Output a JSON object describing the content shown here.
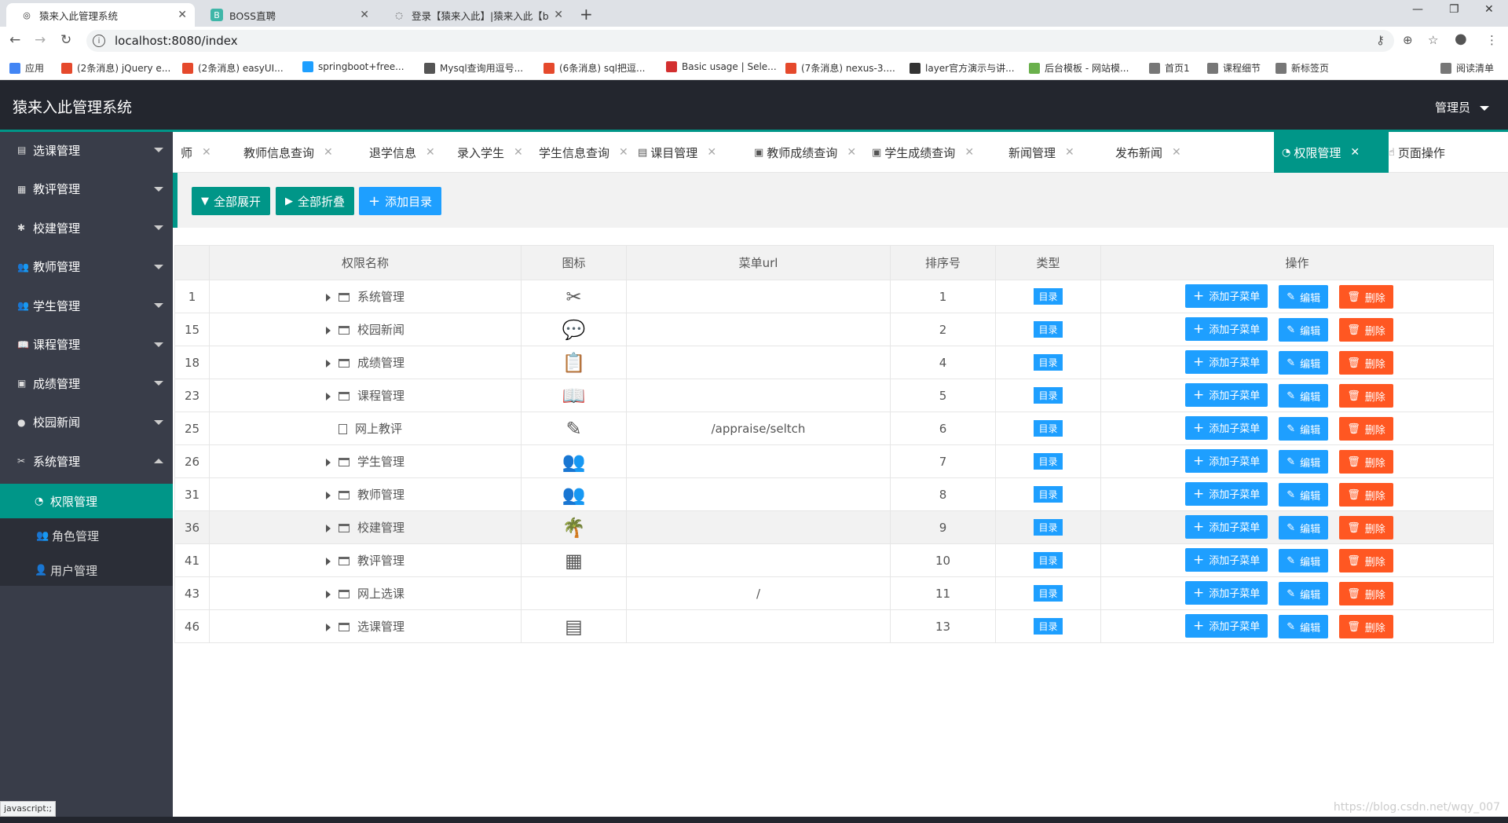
{
  "browser": {
    "tabs": [
      {
        "title": "猿来入此管理系统",
        "active": true
      },
      {
        "title": "BOSS直聘",
        "active": false
      },
      {
        "title": "登录【猿来入此】|猿来入此【be",
        "active": false
      }
    ],
    "url": "localhost:8080/index"
  },
  "bookmarks": [
    {
      "label": "应用",
      "color": "#4285f4"
    },
    {
      "label": "(2条消息) jQuery e...",
      "color": "#e5492c"
    },
    {
      "label": "(2条消息) easyUI...",
      "color": "#e5492c"
    },
    {
      "label": "springboot+free...",
      "color": "#1e9fff"
    },
    {
      "label": "Mysql查询用逗号...",
      "color": "#555555"
    },
    {
      "label": "(6条消息) sql把逗...",
      "color": "#e5492c"
    },
    {
      "label": "Basic usage | Sele...",
      "color": "#d32f2f"
    },
    {
      "label": "(7条消息) nexus-3....",
      "color": "#e5492c"
    },
    {
      "label": "layer官方演示与讲...",
      "color": "#333333"
    },
    {
      "label": "后台模板 - 网站模...",
      "color": "#6ab04c"
    },
    {
      "label": "首页1",
      "color": "#777777"
    },
    {
      "label": "课程细节",
      "color": "#777777"
    },
    {
      "label": "新标签页",
      "color": "#777777"
    },
    {
      "label": "阅读清单",
      "color": "#777777"
    }
  ],
  "app": {
    "title": "猿来入此管理系统",
    "user": "管理员"
  },
  "sidebar": {
    "items": [
      {
        "label": "选课管理",
        "icon": "list-icon"
      },
      {
        "label": "教评管理",
        "icon": "table-icon"
      },
      {
        "label": "校建管理",
        "icon": "palm-icon"
      },
      {
        "label": "教师管理",
        "icon": "users-icon"
      },
      {
        "label": "学生管理",
        "icon": "users-icon"
      },
      {
        "label": "课程管理",
        "icon": "book-icon"
      },
      {
        "label": "成绩管理",
        "icon": "clipboard-icon"
      },
      {
        "label": "校园新闻",
        "icon": "chat-icon"
      },
      {
        "label": "系统管理",
        "icon": "tools-icon"
      }
    ],
    "subitems": [
      {
        "label": "权限管理",
        "icon": "clock-icon",
        "active": true
      },
      {
        "label": "角色管理",
        "icon": "users-icon",
        "active": false
      },
      {
        "label": "用户管理",
        "icon": "user-icon",
        "active": false
      }
    ]
  },
  "status_text": "javascript:;",
  "page_tabs": [
    {
      "label": "师"
    },
    {
      "label": "教师信息查询"
    },
    {
      "label": "退学信息"
    },
    {
      "label": "录入学生"
    },
    {
      "label": "学生信息查询"
    },
    {
      "label": "课目管理"
    },
    {
      "label": "教师成绩查询"
    },
    {
      "label": "学生成绩查询"
    },
    {
      "label": "新闻管理"
    },
    {
      "label": "发布新闻"
    },
    {
      "label": "权限管理",
      "active": true
    },
    {
      "label": "页面操作"
    }
  ],
  "toolbar": {
    "expand_all": "全部展开",
    "collapse_all": "全部折叠",
    "add_dir": "添加目录"
  },
  "table": {
    "headers": [
      "权限名称",
      "图标",
      "菜单url",
      "排序号",
      "类型",
      "操作"
    ],
    "rows": [
      {
        "id": "1",
        "name": "系统管理",
        "icon": "tools-icon",
        "glyph": "✂",
        "url": "",
        "order": "1",
        "type": "目录",
        "folder": true
      },
      {
        "id": "15",
        "name": "校园新闻",
        "icon": "chat-icon",
        "glyph": "💬",
        "url": "",
        "order": "2",
        "type": "目录",
        "folder": true
      },
      {
        "id": "18",
        "name": "成绩管理",
        "icon": "clipboard-icon",
        "glyph": "📋",
        "url": "",
        "order": "4",
        "type": "目录",
        "folder": true
      },
      {
        "id": "23",
        "name": "课程管理",
        "icon": "book-icon",
        "glyph": "📖",
        "url": "",
        "order": "5",
        "type": "目录",
        "folder": true
      },
      {
        "id": "25",
        "name": "网上教评",
        "icon": "question-edit-icon",
        "glyph": "✎",
        "url": "/appraise/seltch",
        "order": "6",
        "type": "目录",
        "folder": false
      },
      {
        "id": "26",
        "name": "学生管理",
        "icon": "users-icon",
        "glyph": "👥",
        "url": "",
        "order": "7",
        "type": "目录",
        "folder": true
      },
      {
        "id": "31",
        "name": "教师管理",
        "icon": "users-icon",
        "glyph": "👥",
        "url": "",
        "order": "8",
        "type": "目录",
        "folder": true
      },
      {
        "id": "36",
        "name": "校建管理",
        "icon": "palm-icon",
        "glyph": "🌴",
        "url": "",
        "order": "9",
        "type": "目录",
        "folder": true,
        "highlight": true
      },
      {
        "id": "41",
        "name": "教评管理",
        "icon": "table-icon",
        "glyph": "▦",
        "url": "",
        "order": "10",
        "type": "目录",
        "folder": true
      },
      {
        "id": "43",
        "name": "网上选课",
        "icon": "",
        "glyph": "",
        "url": "/",
        "order": "11",
        "type": "目录",
        "folder": true
      },
      {
        "id": "46",
        "name": "选课管理",
        "icon": "list-icon",
        "glyph": "▤",
        "url": "",
        "order": "13",
        "type": "目录",
        "folder": true
      }
    ],
    "actions": {
      "add_child": "添加子菜单",
      "edit": "编辑",
      "delete": "删除"
    }
  },
  "watermark": "https://blog.csdn.net/wqy_007",
  "colors": {
    "header": "#23262e",
    "sidebar": "#393d49",
    "accent": "#009688",
    "primary_btn": "#1e9fff",
    "danger_btn": "#ff5722"
  }
}
